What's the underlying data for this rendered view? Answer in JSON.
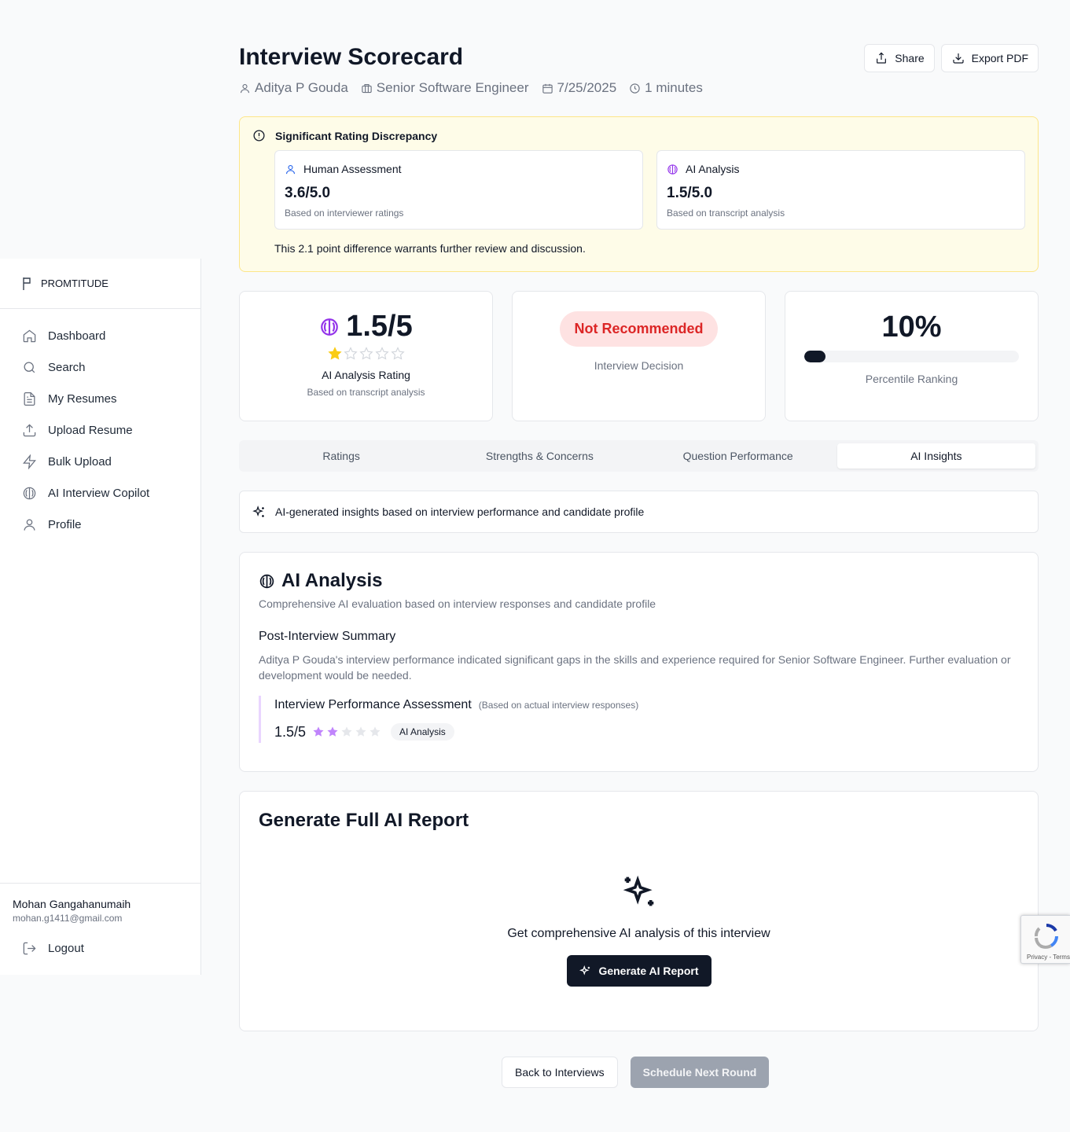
{
  "sidebar": {
    "brand": "PROMTITUDE",
    "items": [
      {
        "label": "Dashboard",
        "icon": "home-icon"
      },
      {
        "label": "Search",
        "icon": "search-icon"
      },
      {
        "label": "My Resumes",
        "icon": "file-icon"
      },
      {
        "label": "Upload Resume",
        "icon": "upload-icon"
      },
      {
        "label": "Bulk Upload",
        "icon": "zap-icon"
      },
      {
        "label": "AI Interview Copilot",
        "icon": "brain-icon"
      },
      {
        "label": "Profile",
        "icon": "user-icon"
      }
    ],
    "user": {
      "name": "Mohan Gangahanumaih",
      "email": "mohan.g1411@gmail.com"
    },
    "logout": "Logout"
  },
  "header": {
    "title": "Interview Scorecard",
    "candidate": "Aditya P Gouda",
    "role": "Senior Software Engineer",
    "date": "7/25/2025",
    "duration": "1 minutes",
    "share": "Share",
    "export": "Export PDF"
  },
  "discrepancy": {
    "title": "Significant Rating Discrepancy",
    "human": {
      "label": "Human Assessment",
      "value": "3.6/5.0",
      "sub": "Based on interviewer ratings"
    },
    "ai": {
      "label": "AI Analysis",
      "value": "1.5/5.0",
      "sub": "Based on transcript analysis"
    },
    "note": "This 2.1 point difference warrants further review and discussion."
  },
  "stats": {
    "ai_rating": {
      "value": "1.5/5",
      "stars": 1,
      "label": "AI Analysis Rating",
      "sub": "Based on transcript analysis"
    },
    "decision": {
      "value": "Not Recommended",
      "label": "Interview Decision"
    },
    "percentile": {
      "value": "10%",
      "fill": 0.1,
      "label": "Percentile Ranking"
    }
  },
  "tabs": [
    "Ratings",
    "Strengths & Concerns",
    "Question Performance",
    "AI Insights"
  ],
  "active_tab": "AI Insights",
  "insight_note": "AI-generated insights based on interview performance and candidate profile",
  "analysis": {
    "title": "AI Analysis",
    "subtitle": "Comprehensive AI evaluation based on interview responses and candidate profile",
    "summary_heading": "Post-Interview Summary",
    "summary": "Aditya P Gouda's interview performance indicated significant gaps in the skills and experience required for Senior Software Engineer. Further evaluation or development would be needed.",
    "assessment_heading": "Interview Performance Assessment",
    "assessment_note": "(Based on actual interview responses)",
    "score": "1.5/5",
    "stars": 2,
    "badge": "AI Analysis"
  },
  "report": {
    "title": "Generate Full AI Report",
    "text": "Get comprehensive AI analysis of this interview",
    "button": "Generate AI Report"
  },
  "footer": {
    "back": "Back to Interviews",
    "next": "Schedule Next Round"
  },
  "recaptcha": {
    "text": "Privacy - Terms"
  },
  "colors": {
    "accent": "#111827",
    "purple": "#9333ea",
    "danger": "#dc2626",
    "warning_bg": "#fefce8",
    "star": "#facc15",
    "star_purple": "#c084fc"
  }
}
